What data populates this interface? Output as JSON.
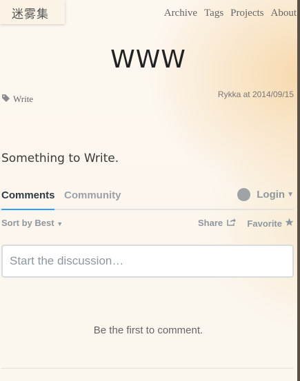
{
  "site": {
    "logo": "迷雾集"
  },
  "nav": {
    "archive": "Archive",
    "tags": "Tags",
    "projects": "Projects",
    "about": "About"
  },
  "post": {
    "title": "WWW",
    "tag": "Write",
    "meta": "Rykka at 2014/09/15",
    "body": "Something to Write."
  },
  "comments": {
    "tabs": {
      "comments": "Comments",
      "community": "Community"
    },
    "login": "Login",
    "sort": "Sort by Best",
    "share": "Share",
    "favorite": "Favorite",
    "placeholder": "Start the discussion…",
    "empty": "Be the first to comment.",
    "accent": "#2e9fff"
  }
}
